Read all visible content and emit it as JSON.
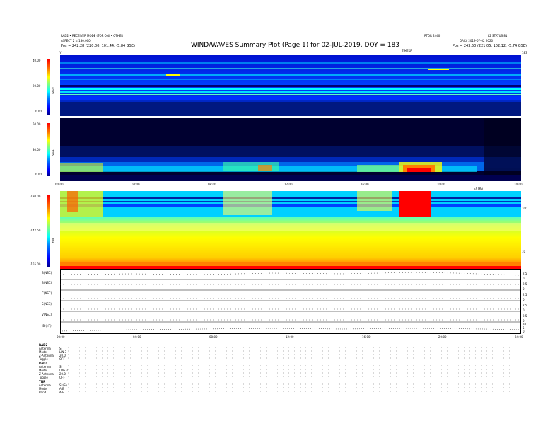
{
  "header": {
    "title": "WIND/WAVES Summary Plot (Page 1) for 02-JUL-2019, DOY = 183",
    "left_line1": "RAD2 • RECEIVER MODE (TOR ON) • OTHER",
    "left_line2": "ASPECT 2 = 180.000",
    "left_line3": "Pos = 242.28 (220.00, 101.44, -5.84 GSE)",
    "center_right_label": "RTOR  2440",
    "right_line1": "L2 STATUS 81",
    "right_line2": "DAILY  2019-07-02 2020",
    "right_line3": "Pos = 243.50 (221.05, 102.12, -5.74 GSE)",
    "sub_label_top": "TIMEKR",
    "corner_left": "Y",
    "corner_right": "183"
  },
  "panels": {
    "rad2": {
      "label": "RAD2",
      "ticks": [
        "40.00",
        "20.00",
        "0.00"
      ]
    },
    "rad1": {
      "label": "RAD1",
      "ticks": [
        "50.00",
        "30.00",
        "0.00"
      ]
    },
    "tnr": {
      "label": "TNR",
      "ticks": [
        "-130.00",
        "-142.50",
        "-155.00"
      ],
      "right_ticks": [
        "100",
        "10"
      ],
      "mid_right_label": "EXTRA"
    }
  },
  "time_axis": {
    "ticks": [
      "00:00",
      "04:00",
      "08:00",
      "12:00",
      "16:00",
      "20:00",
      "24:00"
    ]
  },
  "line_panels": [
    {
      "label": "B(NSC)",
      "right_ticks": [
        "2.5",
        "0"
      ]
    },
    {
      "label": "B(NSC)",
      "right_ticks": [
        "2.5",
        "0"
      ]
    },
    {
      "label": "C(NSC)",
      "right_ticks": [
        "2.5",
        "0"
      ]
    },
    {
      "label": "S(NSC)",
      "right_ticks": [
        "2.5",
        "0"
      ]
    },
    {
      "label": "V(NSC)",
      "right_ticks": [
        "2.5",
        "0"
      ]
    },
    {
      "label": "|B|(nT)",
      "right_ticks": [
        "10",
        "5",
        "0"
      ]
    }
  ],
  "bottom_time_ticks": [
    "00:00",
    "04:00",
    "08:00",
    "12:00",
    "16:00",
    "20:00",
    "24:00"
  ],
  "legend": {
    "rad2_title": "RAD2",
    "rad2_rows": [
      {
        "k": "Antenna",
        "v": "S"
      },
      {
        "k": "Mode",
        "v": "LIN 3"
      },
      {
        "k": "Z-Antenna",
        "v": "20.0"
      },
      {
        "k": "Toggle",
        "v": "OFF"
      }
    ],
    "rad1_title": "RAD1",
    "rad1_rows": [
      {
        "k": "Antenna",
        "v": "S"
      },
      {
        "k": "Mode",
        "v": "LOG 2"
      },
      {
        "k": "Z-Antenna",
        "v": "20.0"
      },
      {
        "k": "Toggle",
        "v": "OFF"
      }
    ],
    "tnr_title": "TNR",
    "tnr_rows": [
      {
        "k": "Antenna",
        "v": "Sx/Sy"
      },
      {
        "k": "Mode",
        "v": "A,B"
      },
      {
        "k": "Band",
        "v": "A-E"
      }
    ]
  },
  "colors": {
    "dark_blue": "#000080",
    "blue": "#0020ff",
    "cyan": "#00e0ff",
    "yellow": "#ffff00",
    "orange": "#ff9000",
    "red": "#ff0000"
  }
}
